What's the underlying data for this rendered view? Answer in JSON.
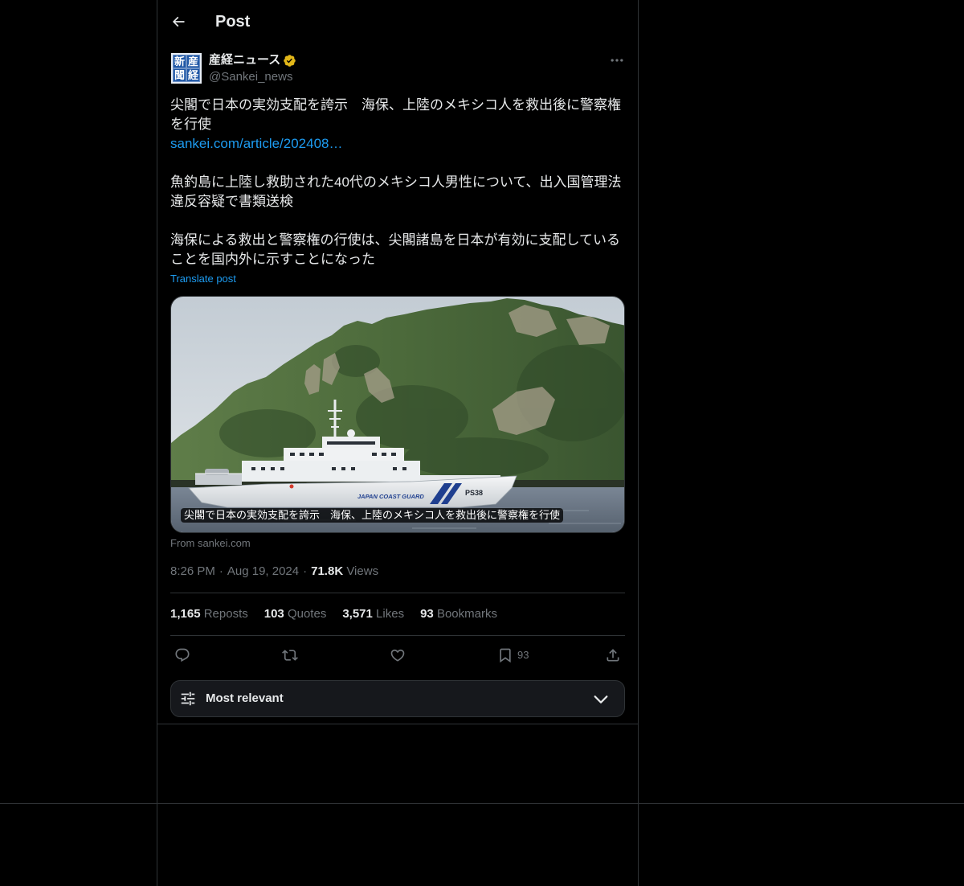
{
  "header": {
    "title": "Post"
  },
  "author": {
    "name": "産経ニュース",
    "handle": "@Sankei_news",
    "verified": true,
    "avatar_logo": [
      "新",
      "産",
      "聞",
      "経"
    ]
  },
  "tweet": {
    "headline": "尖閣で日本の実効支配を誇示　海保、上陸のメキシコ人を救出後に警察権を行使",
    "link": "sankei.com/article/202408…",
    "paragraphs": [
      "魚釣島に上陸し救助された40代のメキシコ人男性について、出入国管理法違反容疑で書類送検",
      "海保による救出と警察権の行使は、尖閣諸島を日本が有効に支配していることを国内外に示すことになった"
    ],
    "translate_label": "Translate post"
  },
  "card": {
    "caption": "尖閣で日本の実効支配を誇示　海保、上陸のメキシコ人を救出後に警察権を行使",
    "source": "From sankei.com",
    "photo": {
      "ship_lettering": "JAPAN COAST GUARD",
      "hull_number": "PS38"
    }
  },
  "meta": {
    "time": "8:26 PM",
    "separator": "·",
    "date": "Aug 19, 2024",
    "views_count": "71.8K",
    "views_label": "Views"
  },
  "stats": [
    {
      "count": "1,165",
      "label": "Reposts"
    },
    {
      "count": "103",
      "label": "Quotes"
    },
    {
      "count": "3,571",
      "label": "Likes"
    },
    {
      "count": "93",
      "label": "Bookmarks"
    }
  ],
  "actions": {
    "bookmark_count": "93"
  },
  "replies_sort": {
    "label": "Most relevant"
  },
  "icons": {
    "back": "arrow-left-icon",
    "verified": "verified-badge-icon",
    "more": "more-dots-icon",
    "reply": "reply-icon",
    "repost": "repost-icon",
    "like": "heart-icon",
    "bookmark": "bookmark-icon",
    "share": "share-icon",
    "sort": "sliders-icon",
    "expand": "chevron-down-icon"
  },
  "colors": {
    "background": "#000000",
    "text_primary": "#e7e9ea",
    "text_secondary": "#71767b",
    "border": "#2f3336",
    "link": "#1d9bf0",
    "verified_gold": "#e2b719"
  }
}
